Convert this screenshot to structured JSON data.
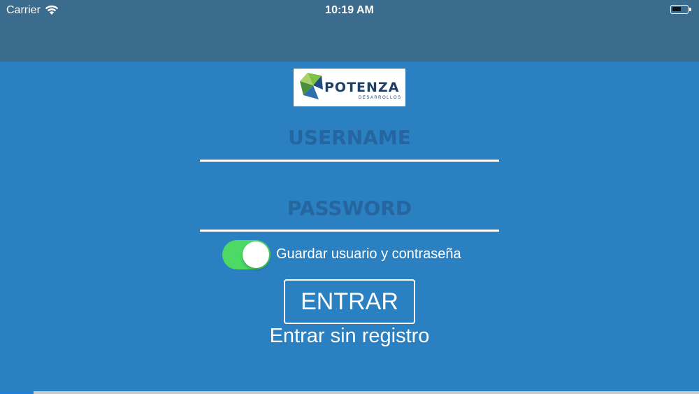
{
  "status_bar": {
    "carrier": "Carrier",
    "time": "10:19 AM",
    "wifi_icon": "wifi-icon",
    "battery_icon": "battery-icon"
  },
  "logo": {
    "name": "POTENZA",
    "subtitle": "DESARROLLOS"
  },
  "form": {
    "username_placeholder": "USERNAME",
    "username_value": "",
    "password_placeholder": "PASSWORD",
    "password_value": "",
    "remember_toggle_on": true,
    "remember_label": "Guardar usuario y contraseña",
    "submit_label": "ENTRAR",
    "guest_link": "Entrar sin registro"
  },
  "colors": {
    "background": "#2a80c0",
    "top_band": "#3b6c8e",
    "toggle_on": "#4cd964",
    "placeholder": "#2565a0"
  }
}
